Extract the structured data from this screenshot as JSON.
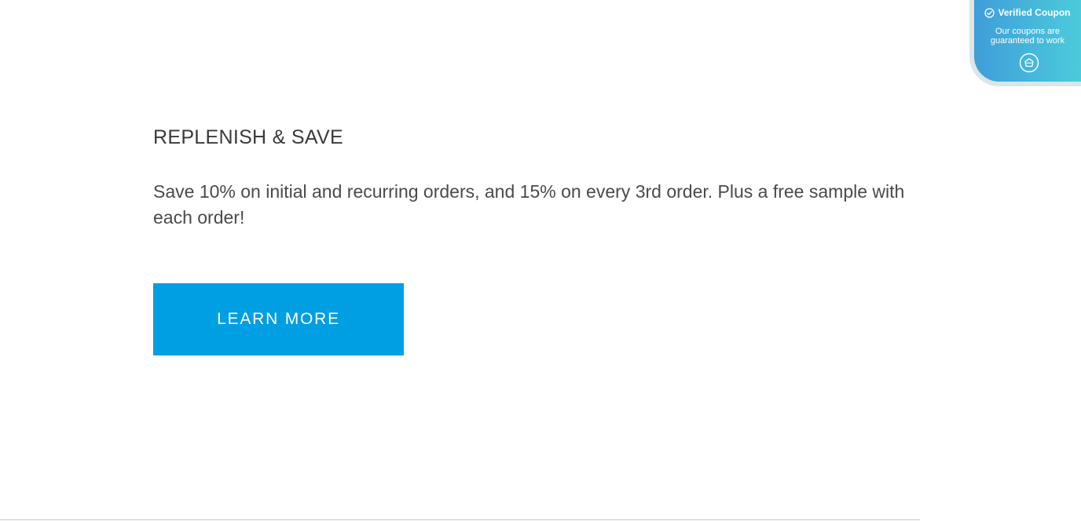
{
  "promo": {
    "heading": "REPLENISH & SAVE",
    "body": "Save 10% on initial and recurring orders, and 15% on every 3rd order. Plus a free sample with each order!",
    "button_label": "LEARN MORE"
  },
  "coupon_badge": {
    "title": "Verified Coupon",
    "subtitle": "Our coupons are guaranteed to work",
    "check_icon": "check-circle-icon",
    "action_icon": "coupon-tag-icon"
  },
  "colors": {
    "button": "#009ee3",
    "heading": "#3a3a3a",
    "body_text": "#4a4a4a",
    "badge_gradient_start": "#3f9ed9",
    "badge_gradient_end": "#4ccbdc"
  }
}
